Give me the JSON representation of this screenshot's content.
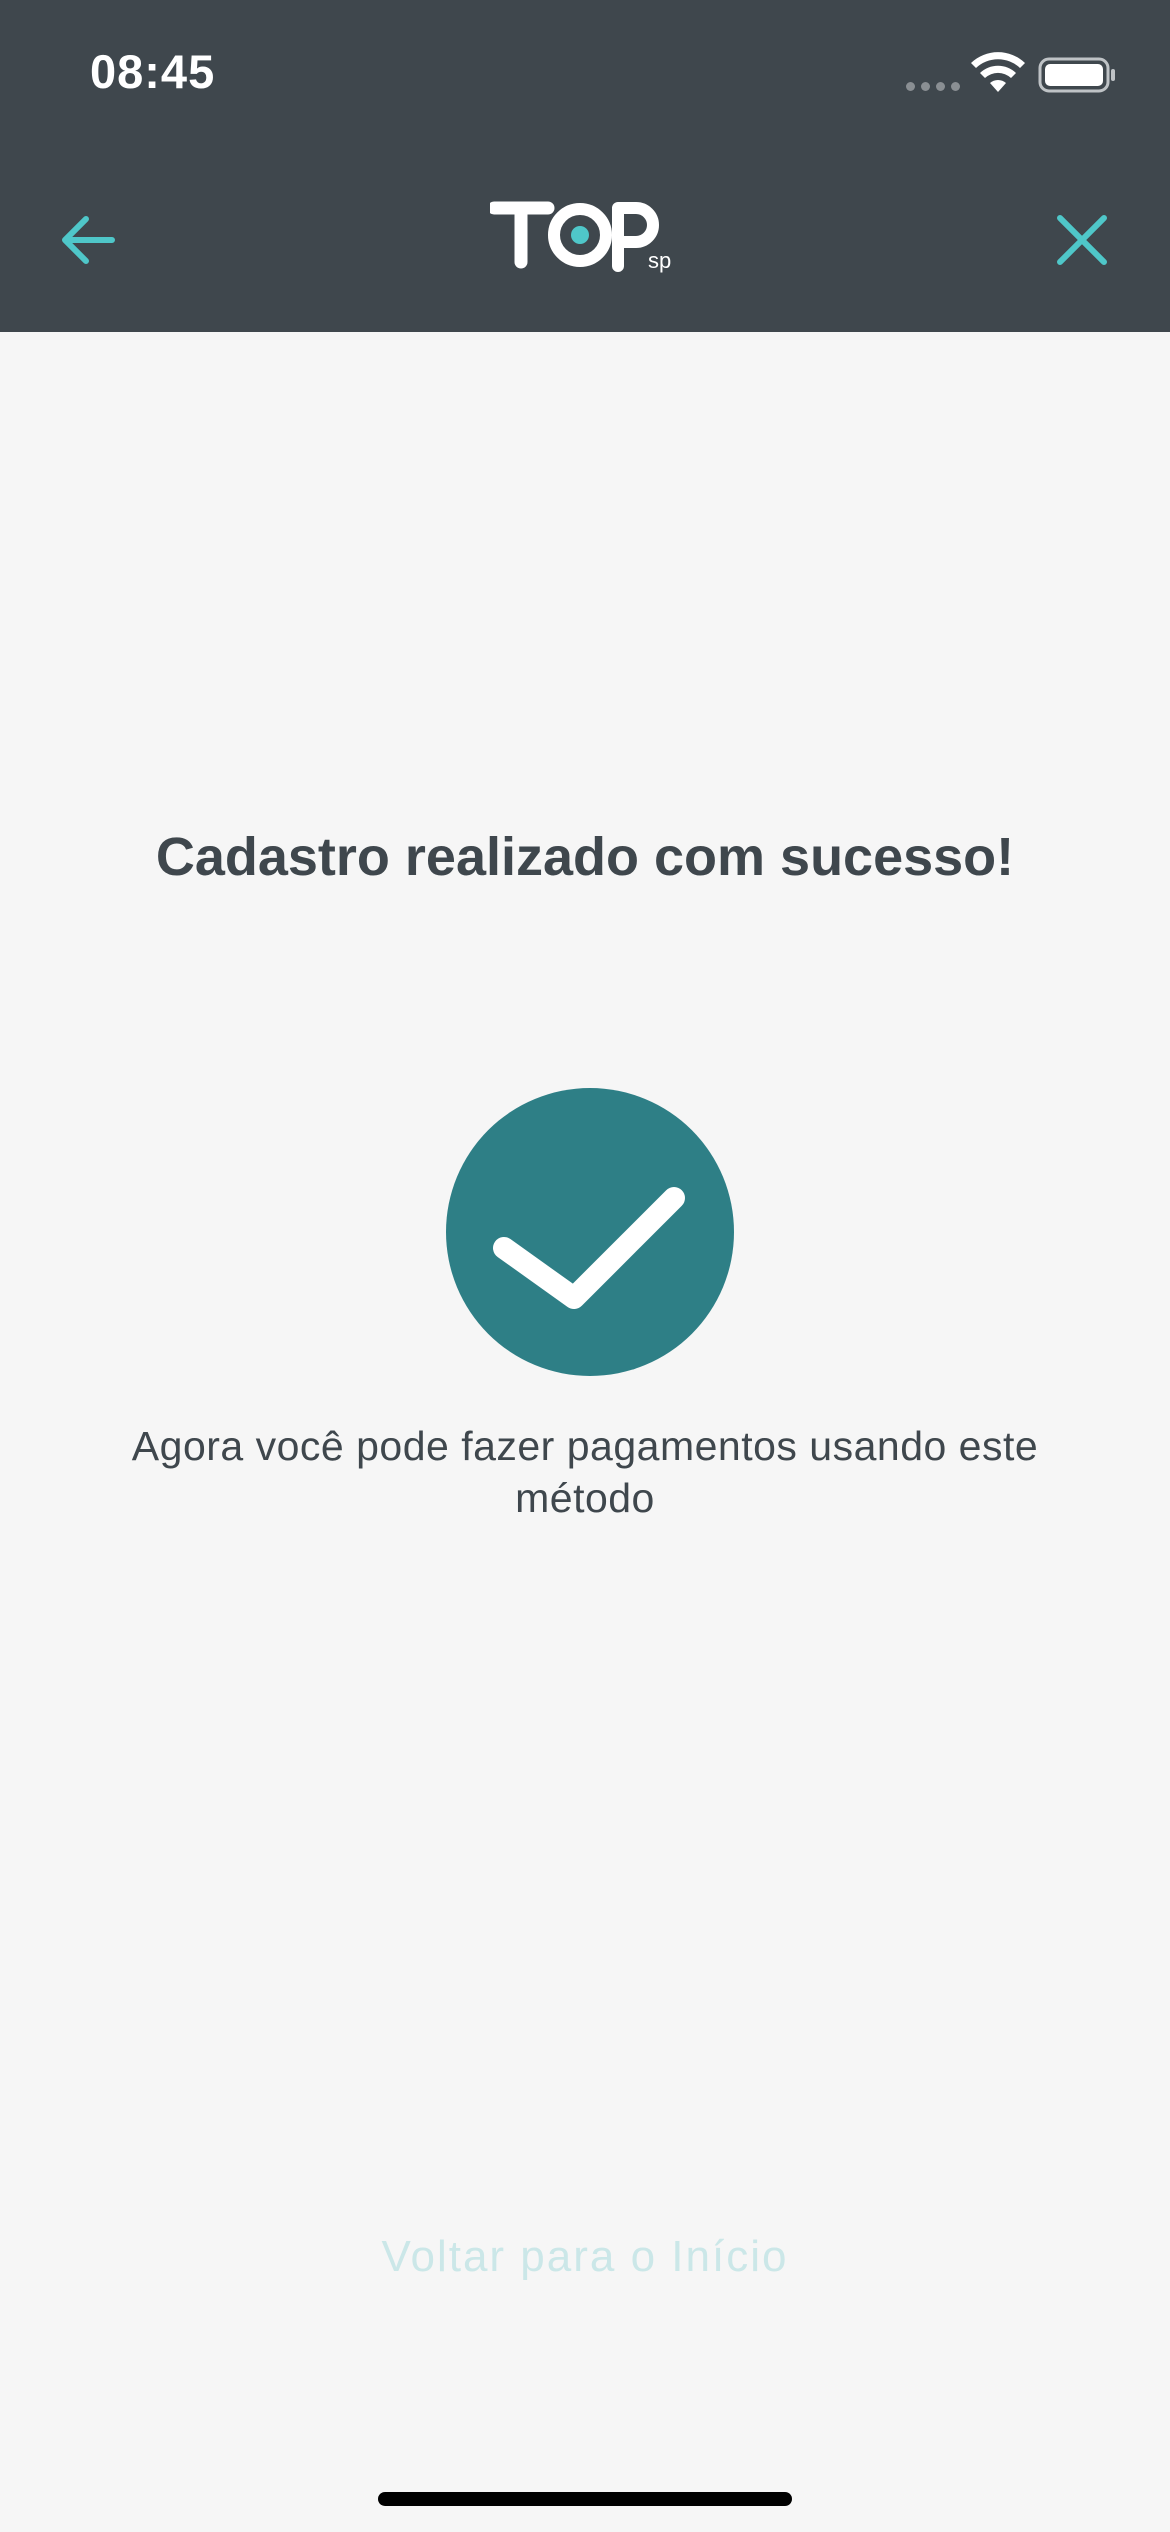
{
  "status_bar": {
    "time": "08:45"
  },
  "nav": {
    "logo_text": "TOP",
    "logo_sub": "sp",
    "back_icon": "arrow-left-icon",
    "close_icon": "close-icon",
    "accent_color": "#4fc7c9"
  },
  "main": {
    "title": "Cadastro realizado com sucesso!",
    "message_line1": "Agora você pode fazer pagamentos usando este",
    "message_line2": "método",
    "success_icon": "check-circle-icon",
    "success_color": "#2e7f86"
  },
  "footer": {
    "home_link_label": "Voltar para o Início"
  },
  "colors": {
    "header_bg": "#3f474d",
    "page_bg": "#f6f6f6",
    "text": "#3f474d",
    "link_disabled": "#cbe7e8"
  }
}
